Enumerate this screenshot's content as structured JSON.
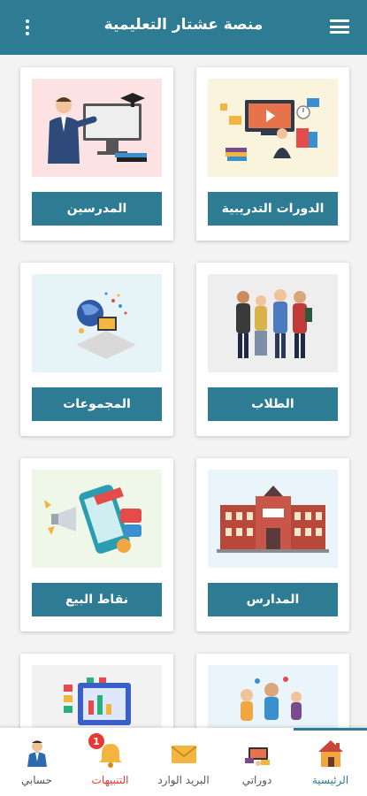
{
  "appbar": {
    "title": "منصة عشتار التعليمية"
  },
  "cards": [
    {
      "label": "الدورات التدريبية",
      "illustration": "training-courses-illustration"
    },
    {
      "label": "المدرسين",
      "illustration": "teacher-illustration"
    },
    {
      "label": "الطلاب",
      "illustration": "students-illustration"
    },
    {
      "label": "المجموعات",
      "illustration": "groups-illustration"
    },
    {
      "label": "المدارس",
      "illustration": "school-building-illustration"
    },
    {
      "label": "نقاط البيع",
      "illustration": "points-of-sale-illustration"
    },
    {
      "label": "",
      "illustration": "people-illustration"
    },
    {
      "label": "",
      "illustration": "dashboard-illustration"
    }
  ],
  "bottom_nav": {
    "items": [
      {
        "label": "الرئيسية",
        "icon": "home-icon",
        "active": true
      },
      {
        "label": "دوراتي",
        "icon": "my-courses-icon"
      },
      {
        "label": "البريد الوارد",
        "icon": "inbox-icon"
      },
      {
        "label": "التنبيهات",
        "icon": "bell-icon",
        "badge": "1"
      },
      {
        "label": "حسابي",
        "icon": "account-icon"
      }
    ]
  },
  "colors": {
    "primary": "#2d7c93",
    "alert": "#e53935",
    "background": "#f3f3f3"
  }
}
